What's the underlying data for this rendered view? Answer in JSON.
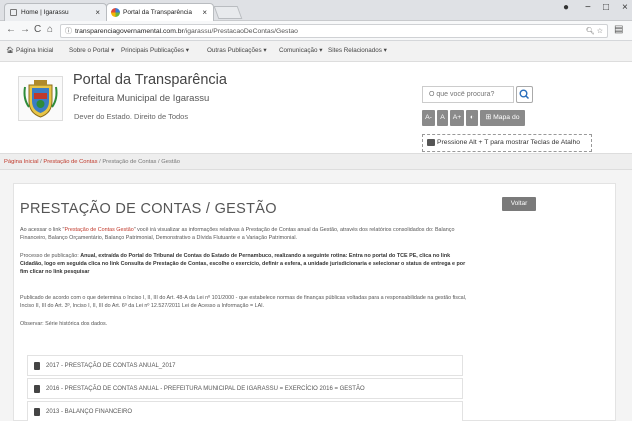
{
  "browser": {
    "tabs": [
      {
        "label": "Home | Igarassu"
      },
      {
        "label": "Portal da Transparência"
      }
    ],
    "url_host": "transparenciagovernamental.com.br",
    "url_path": "/igarassu/PrestacaoDeContas/Gestao",
    "window_controls": [
      "−",
      "□",
      "×"
    ]
  },
  "topmenu": {
    "items": [
      "Página Inicial",
      "Sobre o Portal ▾",
      "Principais Publicações ▾",
      "Outras Publicações ▾",
      "Comunicação ▾",
      "Sites Relacionados ▾"
    ]
  },
  "header": {
    "portal_title": "Portal da Transparência",
    "municipality": "Prefeitura Municipal de Igarassu",
    "slogan": "Dever do Estado. Direito de Todos",
    "search_placeholder": "O que você procura?",
    "font_buttons": [
      "A-",
      "A",
      "A+"
    ],
    "contrast_label": "◐",
    "sitemap_label": "Mapa do Site",
    "shortcut_hint": "Pressione Alt + T para mostrar Teclas de Atalho"
  },
  "breadcrumb": {
    "home": "Página Inicial",
    "sep": " / ",
    "level1": "Prestação de Contas",
    "level2": "Prestação de Contas / Gestão"
  },
  "main": {
    "title": "PRESTAÇÃO DE CONTAS / GESTÃO",
    "back_label": "Voltar",
    "p1_before": "Ao acessar o link \"",
    "p1_link": "Prestação de Contas Gestão",
    "p1_after": "\" você irá visualizar as informações relativas à Prestação de Contas anual da Gestão, através dos relatórios consolidados do: Balanço Financeiro, Balanço Orçamentário, Balanço Patrimonial, Demonstrativo a Dívida Flutuante e a Variação Patrimonial.",
    "p2_before": "Processo de publicação: ",
    "p2_bold": "Anual, extraída do Portal  do Tribunal de Contas do Estado de Pernambuco, realizando a seguinte rotina: Entra no portal do TCE PE, clica no link Cidadão, logo em seguida clica no link Consulta de Prestação de Contas, escolhe o exercício, definir a esfera, a unidade jurisdicionaria e selecionar o status de entrega e por fim clicar no link pesquisar",
    "p3": "Publicado de acordo com o que determina o Inciso I, II, III do Art. 48-A da Lei nº 101/2000 - que estabelece normas de finanças públicas voltadas para a responsabilidade na gestão fiscal, Inciso II, III do Art. 3º, Inciso I, II, III do Art. 6º da Lei nº 12.527/2011 Lei de Acesso a Informação = LAI.",
    "p4": "Observar: Série histórica dos dados.",
    "documents": [
      {
        "label": "2017 - PRESTAÇÃO DE CONTAS ANUAL_2017"
      },
      {
        "label": "2016 - PRESTAÇÃO DE CONTAS ANUAL - PREFEITURA MUNICIPAL DE IGARASSU = EXERCÍCIO 2016 = GESTÃO"
      },
      {
        "label": "2013 - BALANÇO FINANCEIRO"
      }
    ]
  },
  "colors": {
    "link_red": "#c0392b",
    "button_gray": "#7a7a7a",
    "search_blue": "#2a6ebb"
  }
}
